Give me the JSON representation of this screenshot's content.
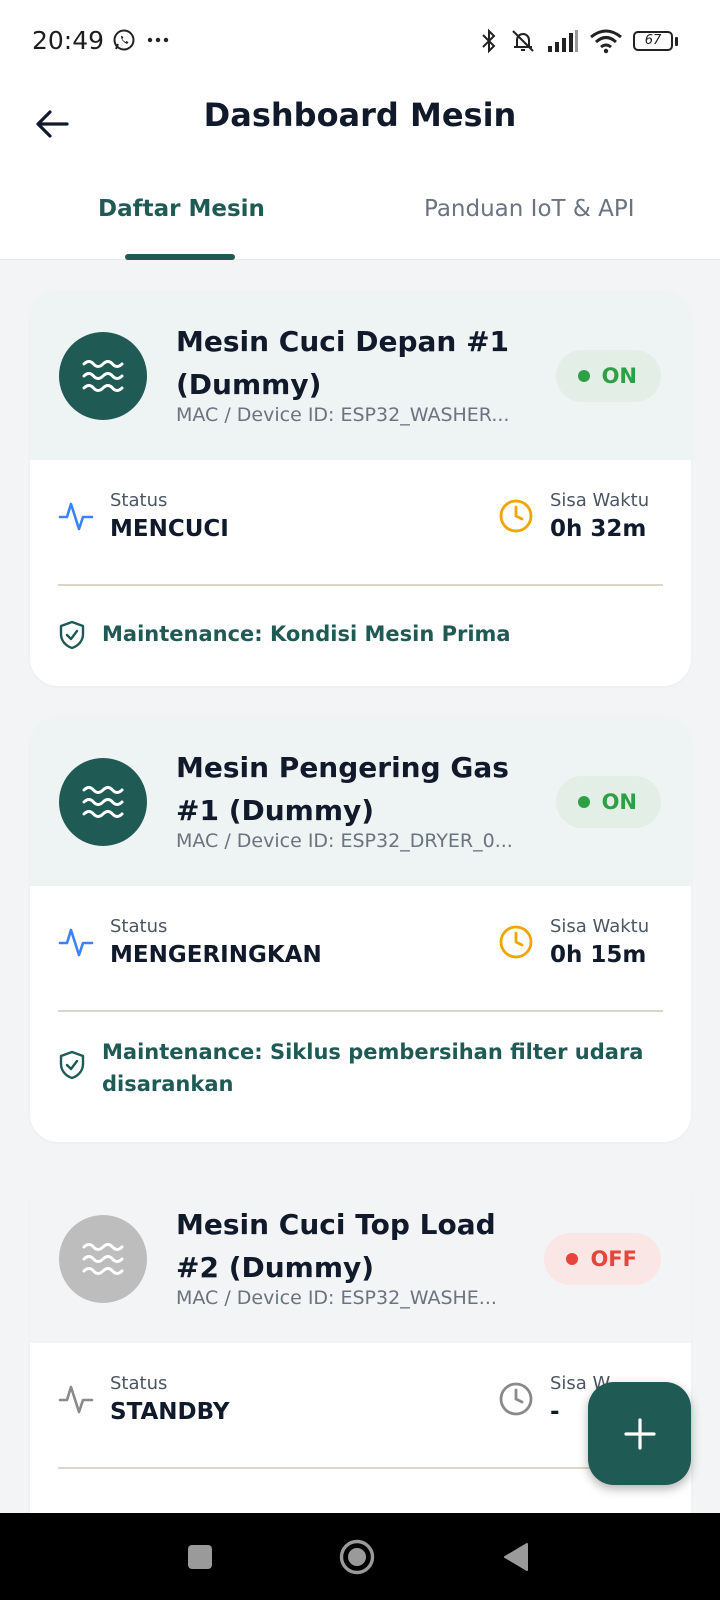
{
  "status_bar": {
    "time": "20:49",
    "battery": "67"
  },
  "app_bar": {
    "title": "Dashboard Mesin"
  },
  "tabs": [
    {
      "label": "Daftar Mesin",
      "active": true
    },
    {
      "label": "Panduan IoT & API",
      "active": false
    }
  ],
  "machines": [
    {
      "name": "Mesin Cuci Depan #1 (Dummy)",
      "mac": "MAC / Device ID: ESP32_WASHER...",
      "state": "ON",
      "status_label": "Status",
      "status_value": "MENCUCI",
      "time_label": "Sisa Waktu",
      "time_value": "0h 32m",
      "maintenance": "Maintenance: Kondisi Mesin Prima"
    },
    {
      "name": "Mesin Pengering Gas #1 (Dummy)",
      "mac": "MAC / Device ID: ESP32_DRYER_0...",
      "state": "ON",
      "status_label": "Status",
      "status_value": "MENGERINGKAN",
      "time_label": "Sisa Waktu",
      "time_value": "0h 15m",
      "maintenance": "Maintenance: Siklus pembersihan filter udara disarankan"
    },
    {
      "name": "Mesin Cuci Top Load #2 (Dummy)",
      "mac": "MAC / Device ID: ESP32_WASHE...",
      "state": "OFF",
      "status_label": "Status",
      "status_value": "STANDBY",
      "time_label": "Sisa W",
      "time_value": "-"
    }
  ],
  "colors": {
    "primary": "#1f5a55",
    "on_green": "#2ea043",
    "off_red": "#e5453a",
    "status_icon_blue": "#3b82f6",
    "clock_amber": "#f0a500"
  },
  "icons": {
    "fab": "plus-icon",
    "back": "arrow-left-icon",
    "machine": "waves-icon"
  }
}
